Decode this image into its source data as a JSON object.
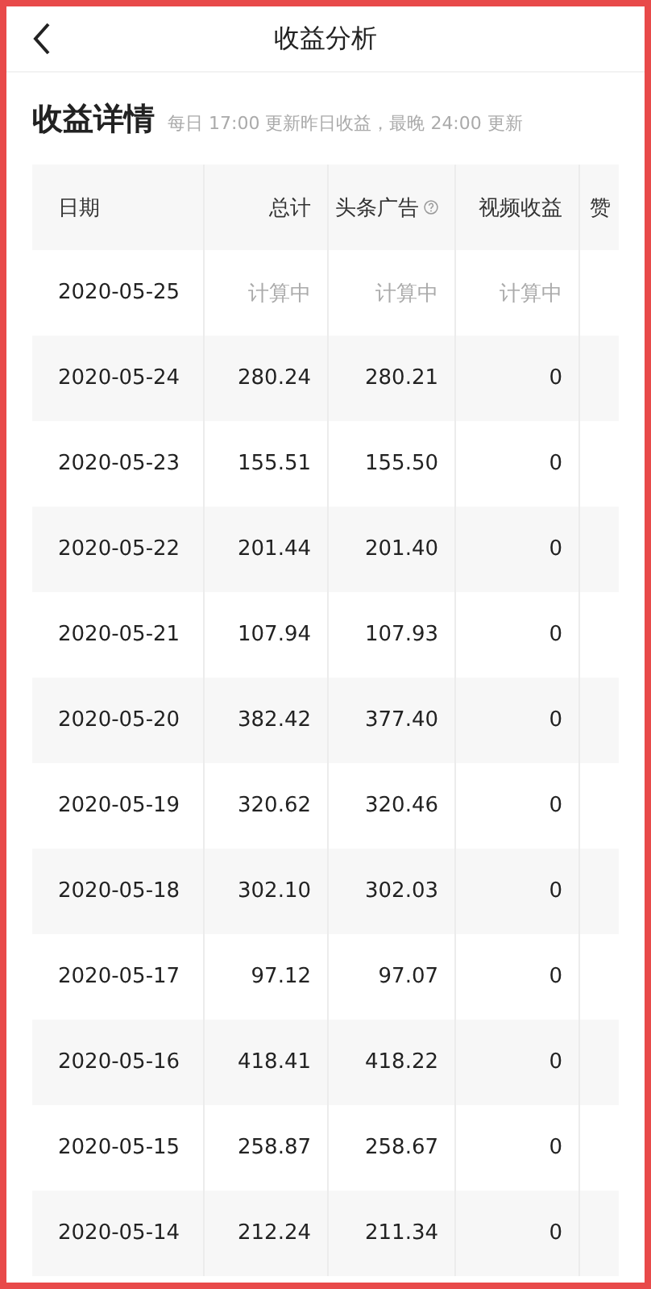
{
  "nav": {
    "title": "收益分析"
  },
  "section": {
    "title": "收益详情",
    "note": "每日 17:00 更新昨日收益，最晚 24:00 更新"
  },
  "table": {
    "columns": [
      {
        "label": "日期",
        "help": false
      },
      {
        "label": "总计",
        "help": false
      },
      {
        "label": "头条广告",
        "help": true
      },
      {
        "label": "视频收益",
        "help": false
      },
      {
        "label": "赞",
        "help": false
      }
    ],
    "rows": [
      {
        "date": "2020-05-25",
        "total": "计算中",
        "ads": "计算中",
        "video": "计算中",
        "pending": true
      },
      {
        "date": "2020-05-24",
        "total": "280.24",
        "ads": "280.21",
        "video": "0",
        "pending": false
      },
      {
        "date": "2020-05-23",
        "total": "155.51",
        "ads": "155.50",
        "video": "0",
        "pending": false
      },
      {
        "date": "2020-05-22",
        "total": "201.44",
        "ads": "201.40",
        "video": "0",
        "pending": false
      },
      {
        "date": "2020-05-21",
        "total": "107.94",
        "ads": "107.93",
        "video": "0",
        "pending": false
      },
      {
        "date": "2020-05-20",
        "total": "382.42",
        "ads": "377.40",
        "video": "0",
        "pending": false
      },
      {
        "date": "2020-05-19",
        "total": "320.62",
        "ads": "320.46",
        "video": "0",
        "pending": false
      },
      {
        "date": "2020-05-18",
        "total": "302.10",
        "ads": "302.03",
        "video": "0",
        "pending": false
      },
      {
        "date": "2020-05-17",
        "total": "97.12",
        "ads": "97.07",
        "video": "0",
        "pending": false
      },
      {
        "date": "2020-05-16",
        "total": "418.41",
        "ads": "418.22",
        "video": "0",
        "pending": false
      },
      {
        "date": "2020-05-15",
        "total": "258.87",
        "ads": "258.67",
        "video": "0",
        "pending": false
      },
      {
        "date": "2020-05-14",
        "total": "212.24",
        "ads": "211.34",
        "video": "0",
        "pending": false
      }
    ]
  }
}
